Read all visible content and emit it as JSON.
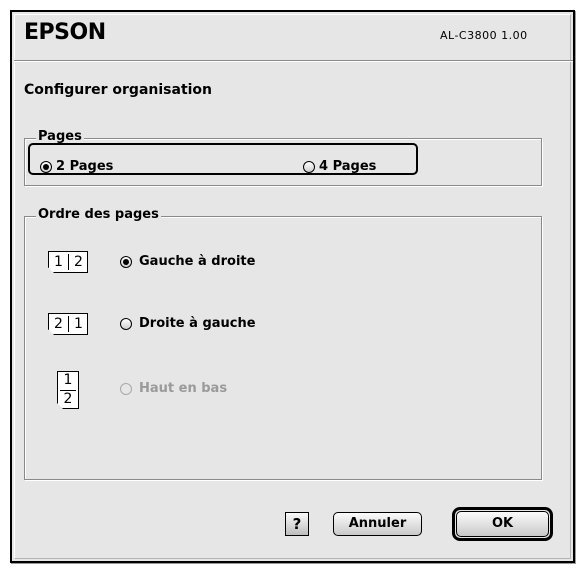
{
  "header": {
    "brand": "EPSON",
    "model": "AL-C3800 1.00"
  },
  "section_title": "Configurer organisation",
  "pages_group": {
    "label": "Pages",
    "options": [
      {
        "label": "2 Pages",
        "checked": true
      },
      {
        "label": "4 Pages",
        "checked": false
      }
    ]
  },
  "order_group": {
    "label": "Ordre des pages",
    "options": [
      {
        "label": "Gauche à droite",
        "checked": true,
        "enabled": true,
        "icon": {
          "first": "1",
          "second": "2"
        }
      },
      {
        "label": "Droite à gauche",
        "checked": false,
        "enabled": true,
        "icon": {
          "first": "2",
          "second": "1"
        }
      },
      {
        "label": "Haut en bas",
        "checked": false,
        "enabled": false,
        "icon": {
          "first": "1",
          "second": "2"
        }
      }
    ]
  },
  "buttons": {
    "help": "?",
    "cancel": "Annuler",
    "ok": "OK"
  }
}
